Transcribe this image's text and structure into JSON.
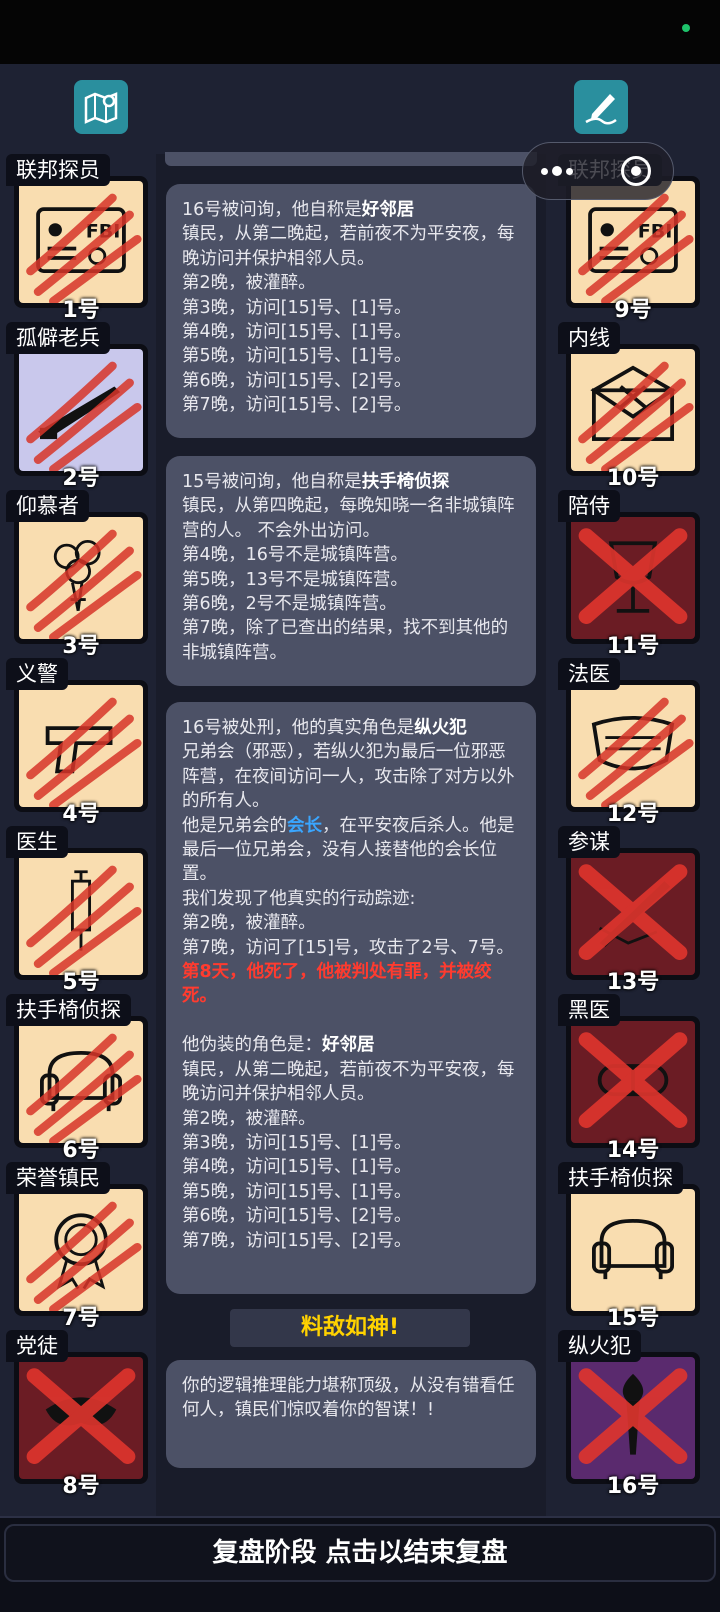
{
  "top_icons": {
    "left": "map-pin-icon",
    "right": "note-pen-icon"
  },
  "left_cards": [
    {
      "name": "联邦探员",
      "num": "1号",
      "bg": "#f9ddb0",
      "icon": "fbi-badge-icon",
      "state": "claw"
    },
    {
      "name": "孤僻老兵",
      "num": "2号",
      "bg": "#c9c8ec",
      "icon": "rifle-icon",
      "state": "claw"
    },
    {
      "name": "仰慕者",
      "num": "3号",
      "bg": "#f9ddb0",
      "icon": "bouquet-icon",
      "state": "claw"
    },
    {
      "name": "义警",
      "num": "4号",
      "bg": "#f9ddb0",
      "icon": "pistol-icon",
      "state": "claw"
    },
    {
      "name": "医生",
      "num": "5号",
      "bg": "#f9ddb0",
      "icon": "syringe-icon",
      "state": "claw"
    },
    {
      "name": "扶手椅侦探",
      "num": "6号",
      "bg": "#f9ddb0",
      "icon": "armchair-icon",
      "state": "claw"
    },
    {
      "name": "荣誉镇民",
      "num": "7号",
      "bg": "#f9ddb0",
      "icon": "medal-icon",
      "state": "claw"
    },
    {
      "name": "党徒",
      "num": "8号",
      "bg": "#6b1c24",
      "icon": "mask-icon",
      "state": "x"
    }
  ],
  "right_cards": [
    {
      "name": "联邦探员",
      "num": "9号",
      "bg": "#f9ddb0",
      "icon": "fbi-badge-icon",
      "state": "claw"
    },
    {
      "name": "内线",
      "num": "10号",
      "bg": "#f9ddb0",
      "icon": "envelope-icon",
      "state": "claw"
    },
    {
      "name": "陪侍",
      "num": "11号",
      "bg": "#6b1c24",
      "icon": "wine-glass-icon",
      "state": "x"
    },
    {
      "name": "法医",
      "num": "12号",
      "bg": "#f9ddb0",
      "icon": "face-mask-icon",
      "state": "claw"
    },
    {
      "name": "参谋",
      "num": "13号",
      "bg": "#6b1c24",
      "icon": "quill-icon",
      "state": "x"
    },
    {
      "name": "黑医",
      "num": "14号",
      "bg": "#6b1c24",
      "icon": "pill-icon",
      "state": "x"
    },
    {
      "name": "扶手椅侦探",
      "num": "15号",
      "bg": "#f9ddb0",
      "icon": "armchair-icon",
      "state": "none"
    },
    {
      "name": "纵火犯",
      "num": "16号",
      "bg": "#5a2a6e",
      "icon": "torch-icon",
      "state": "x"
    }
  ],
  "messages": {
    "m1": {
      "prefix": "16号被问询，他自称是",
      "role": "好邻居",
      "lines": [
        "镇民，从第二晚起，若前夜不为平安夜，每晚访问并保护相邻人员。",
        "第2晚，被灌醉。",
        "第3晚，访问[15]号、[1]号。",
        "第4晚，访问[15]号、[1]号。",
        "第5晚，访问[15]号、[1]号。",
        "第6晚，访问[15]号、[2]号。",
        "第7晚，访问[15]号、[2]号。"
      ]
    },
    "m2": {
      "prefix": "15号被问询，他自称是",
      "role": "扶手椅侦探",
      "lines": [
        "镇民，从第四晚起，每晚知晓一名非城镇阵营的人。 不会外出访问。",
        "第4晚，16号不是城镇阵营。",
        "第5晚，13号不是城镇阵营。",
        "第6晚，2号不是城镇阵营。",
        "第7晚，除了已查出的结果，找不到其他的非城镇阵营。"
      ]
    },
    "m3": {
      "prefix": "16号被处刑，他的真实角色是",
      "role": "纵火犯",
      "line1": "兄弟会（邪恶），若纵火犯为最后一位邪恶阵营，在夜间访问一人，攻击除了对方以外的所有人。",
      "pre_link": "他是兄弟会的",
      "link": "会长",
      "post_link": "，在平安夜后杀人。他是最后一位兄弟会，没有人接替他的会长位置。",
      "trace": [
        "我们发现了他真实的行动踪迹:",
        "第2晚，被灌醉。",
        "第7晚，访问了[15]号，攻击了2号、7号。"
      ],
      "death": "第8天，他死了，他被判处有罪，并被绞死。",
      "disguise_prefix": "他伪装的角色是：",
      "disguise_role": "好邻居",
      "disguise_lines": [
        "镇民，从第二晚起，若前夜不为平安夜，每晚访问并保护相邻人员。",
        "第2晚，被灌醉。",
        "第3晚，访问[15]号、[1]号。",
        "第4晚，访问[15]号、[1]号。",
        "第5晚，访问[15]号、[1]号。",
        "第6晚，访问[15]号、[2]号。",
        "第7晚，访问[15]号、[2]号。"
      ]
    },
    "banner": "料敌如神!",
    "m4": "你的逻辑推理能力堪称顶级，从没有错看任何人，镇民们惊叹着你的智谋！!"
  },
  "footer": "复盘阶段 点击以结束复盘"
}
